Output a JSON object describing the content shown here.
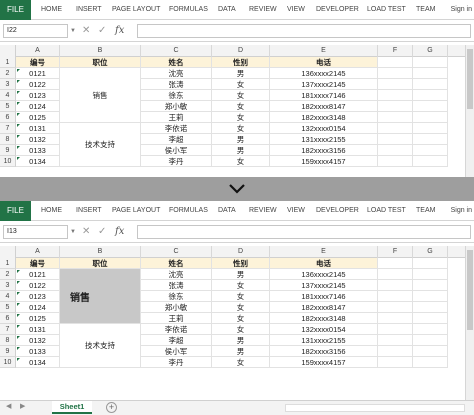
{
  "ribbon": {
    "file": "FILE",
    "tabs": [
      "HOME",
      "INSERT",
      "PAGE LAYOUT",
      "FORMULAS",
      "DATA",
      "REVIEW",
      "VIEW",
      "DEVELOPER",
      "LOAD TEST",
      "TEAM"
    ],
    "sign_in": "Sign in"
  },
  "top": {
    "name_box": "I22"
  },
  "bottom": {
    "name_box": "I13",
    "merged_sales_label": "销售"
  },
  "formula": {
    "fx": "fx",
    "cancel": "✕",
    "confirm": "✓"
  },
  "columns": [
    "A",
    "B",
    "C",
    "D",
    "E",
    "F",
    "G"
  ],
  "row_numbers": [
    "1",
    "2",
    "3",
    "4",
    "5",
    "6",
    "7",
    "8",
    "9",
    "10"
  ],
  "headers": [
    "编号",
    "职位",
    "姓名",
    "性别",
    "电话"
  ],
  "ids": [
    "0121",
    "0122",
    "0123",
    "0124",
    "0125",
    "0131",
    "0132",
    "0133",
    "0134"
  ],
  "positions": {
    "sales": "销售",
    "tech": "技术支持"
  },
  "names": [
    "沈亮",
    "张涛",
    "徐东",
    "郑小敏",
    "王莉",
    "李依诺",
    "李超",
    "侯小军",
    "李丹"
  ],
  "genders": [
    "男",
    "女",
    "女",
    "女",
    "女",
    "女",
    "男",
    "男",
    "女"
  ],
  "phones": [
    "136xxxx2145",
    "137xxxx2145",
    "181xxxx7146",
    "182xxxx8147",
    "182xxxx3148",
    "132xxxx0154",
    "131xxxx2155",
    "182xxxx3156",
    "159xxxx4157"
  ],
  "status": {
    "sheet_tab": "Sheet1",
    "add": "+"
  },
  "colors": {
    "accent": "#217346",
    "header_fill": "#fdf3d9",
    "merge_fill": "#c8c8c8"
  }
}
